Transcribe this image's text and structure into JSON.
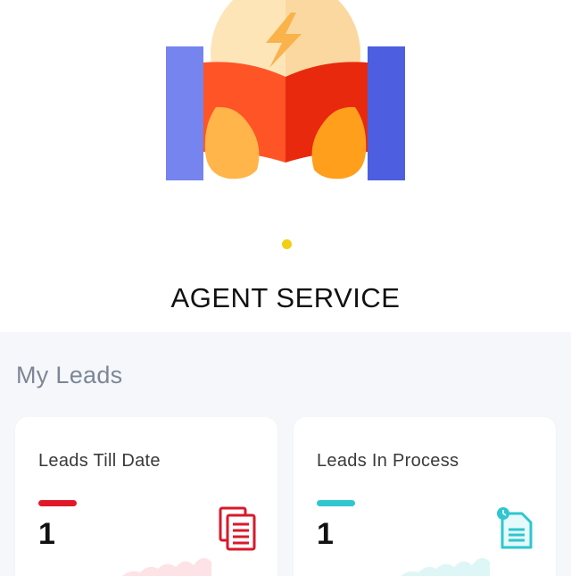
{
  "hero": {
    "title": "AGENT SERVICE",
    "illustration": "open-book-lightning-icon",
    "carousel_active_index": 0,
    "carousel_count": 1
  },
  "leads": {
    "heading": "My Leads",
    "cards": [
      {
        "title": "Leads Till Date",
        "count": "1",
        "accent": "#e0192a",
        "icon": "documents-icon"
      },
      {
        "title": "Leads In Process",
        "count": "1",
        "accent": "#2fc6cf",
        "icon": "document-clock-icon"
      }
    ]
  },
  "colors": {
    "dot": "#f2cf14",
    "section_bg": "#f6f7fa"
  }
}
